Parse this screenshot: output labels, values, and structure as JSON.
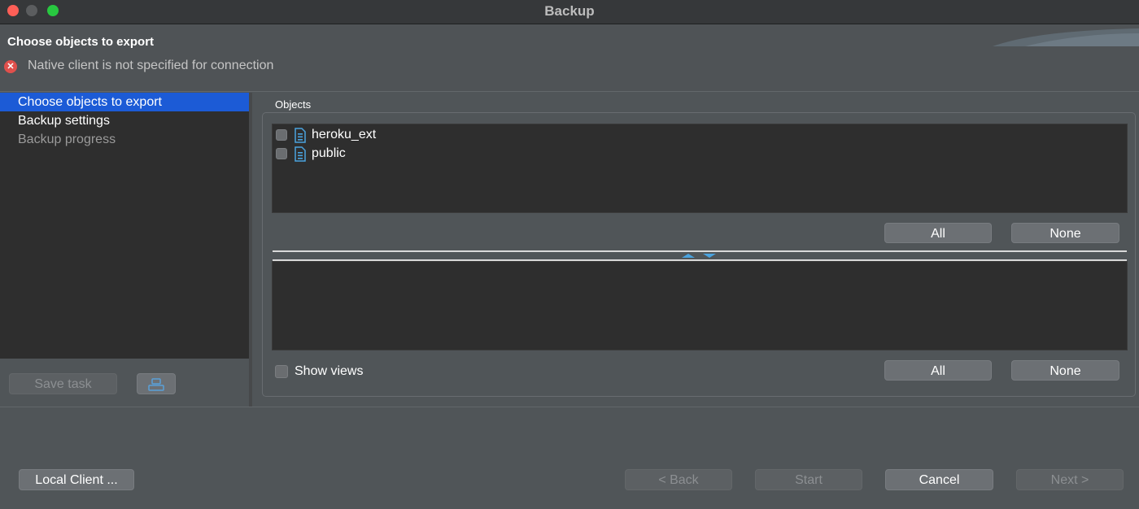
{
  "window": {
    "title": "Backup"
  },
  "header": {
    "title": "Choose objects to export",
    "error_message": "Native client is not specified for connection"
  },
  "nav": {
    "items": [
      {
        "label": "Choose objects to export"
      },
      {
        "label": "Backup settings"
      },
      {
        "label": "Backup progress"
      }
    ],
    "save_task_label": "Save task"
  },
  "objects": {
    "group_label": "Objects",
    "schemas": [
      {
        "label": "heroku_ext",
        "checked": false,
        "icon": "schema-icon"
      },
      {
        "label": "public",
        "checked": false,
        "icon": "schema-icon"
      }
    ],
    "all_label": "All",
    "none_label": "None",
    "show_views_label": "Show views"
  },
  "footer": {
    "local_client_label": "Local Client ...",
    "back_label": "< Back",
    "start_label": "Start",
    "cancel_label": "Cancel",
    "next_label": "Next >"
  },
  "colors": {
    "selection": "#1c5bd6",
    "error": "#e0504c",
    "schema_icon": "#4aa3df"
  }
}
